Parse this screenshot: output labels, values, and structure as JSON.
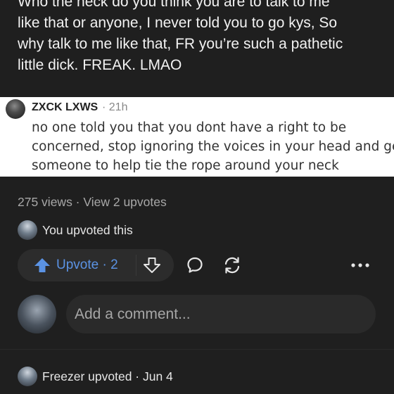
{
  "post": {
    "lines": [
      "Who the heck do you think you are to talk to me",
      "like that or anyone, I never told you to go kys, So",
      "why talk to me like that, FR you’re such a pathetic",
      "little dick. FREAK. LMAO"
    ]
  },
  "quoted_comment": {
    "username": "ZXCK LXWS",
    "time": "· 21h",
    "lines": [
      "no one told you that you dont have a right to be",
      "concerned, stop ignoring the voices in your head and get",
      "someone to help tie the rope around your neck"
    ]
  },
  "stats": {
    "text": "275 views · View 2 upvotes"
  },
  "self_upvote": {
    "text": "You upvoted this"
  },
  "actions": {
    "upvote_label": "Upvote · 2",
    "accent_color": "#5b93e4",
    "icons": [
      "upvote-arrow-icon",
      "downvote-arrow-icon",
      "comment-bubble-icon",
      "share-refresh-icon",
      "more-options-icon"
    ]
  },
  "comment_box": {
    "placeholder": "Add a comment..."
  },
  "activity": {
    "text": "Freezer upvoted · Jun 4"
  }
}
